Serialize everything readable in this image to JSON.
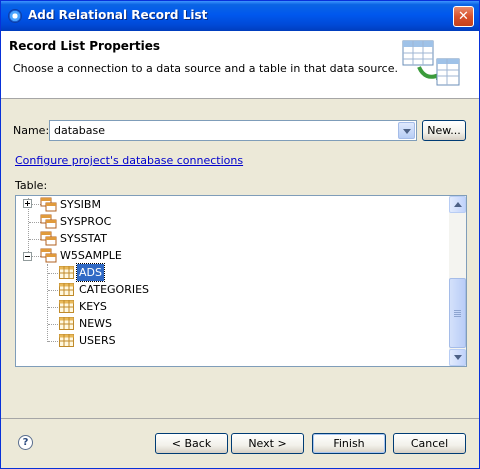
{
  "window": {
    "title": "Add Relational Record List",
    "close_glyph": "✕"
  },
  "header": {
    "title": "Record List Properties",
    "description": "Choose a connection to a data source and a table in that data source."
  },
  "name_field": {
    "label": "Name:",
    "value": "database",
    "new_button": "New..."
  },
  "config_link": "Configure project's database connections",
  "table_label": "Table:",
  "tree": {
    "items": [
      {
        "label": "SYSIBM",
        "type": "schema",
        "expander": "plus"
      },
      {
        "label": "SYSPROC",
        "type": "schema",
        "expander": "none"
      },
      {
        "label": "SYSSTAT",
        "type": "schema",
        "expander": "none"
      },
      {
        "label": "W5SAMPLE",
        "type": "schema",
        "expander": "minus"
      },
      {
        "label": "ADS",
        "type": "table",
        "selected": true
      },
      {
        "label": "CATEGORIES",
        "type": "table"
      },
      {
        "label": "KEYS",
        "type": "table"
      },
      {
        "label": "NEWS",
        "type": "table"
      },
      {
        "label": "USERS",
        "type": "table"
      }
    ]
  },
  "footer": {
    "help_glyph": "?",
    "back": "< Back",
    "next": "Next >",
    "finish": "Finish",
    "cancel": "Cancel"
  },
  "colors": {
    "selection": "#316ac5",
    "link": "#0000cc",
    "dialog_bg": "#ece9d8"
  }
}
